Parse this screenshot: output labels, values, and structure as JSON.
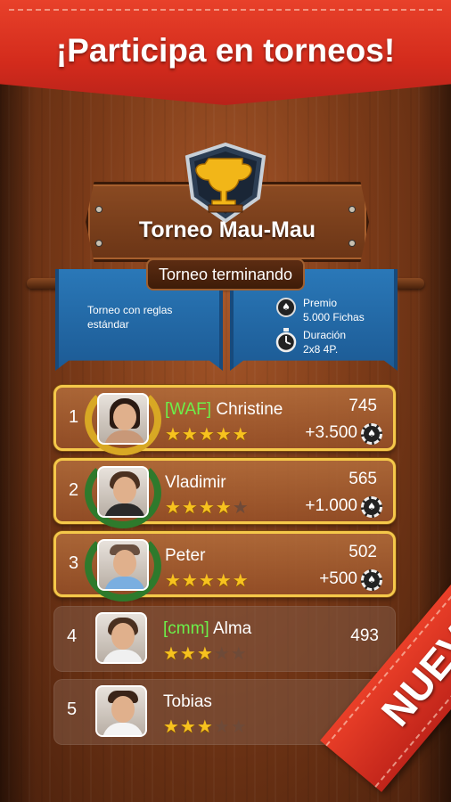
{
  "header": {
    "title": "¡Participa en torneos!"
  },
  "tournament": {
    "title": "Torneo Mau-Mau",
    "status": "Torneo terminando",
    "rules": "Torneo con reglas estándar",
    "prize_label": "Premio",
    "prize_value": "5.000 Fichas",
    "duration_label": "Duración",
    "duration_value": "2x8 4P."
  },
  "leaderboard": [
    {
      "rank": "1",
      "tag": "[WAF]",
      "name": "Christine",
      "score": "745",
      "prize": "+3.500",
      "stars": 5,
      "highlight": true
    },
    {
      "rank": "2",
      "tag": "",
      "name": "Vladimir",
      "score": "565",
      "prize": "+1.000",
      "stars": 4,
      "highlight": true
    },
    {
      "rank": "3",
      "tag": "",
      "name": "Peter",
      "score": "502",
      "prize": "+500",
      "stars": 5,
      "highlight": true
    },
    {
      "rank": "4",
      "tag": "[cmm]",
      "name": "Alma",
      "score": "493",
      "prize": "",
      "stars": 3,
      "highlight": false
    },
    {
      "rank": "5",
      "tag": "",
      "name": "Tobias",
      "score": "",
      "prize": "",
      "stars": 3,
      "highlight": false
    }
  ],
  "badge": {
    "text": "NUEVO"
  },
  "colors": {
    "ribbon": "#d32b1c",
    "tag": "#6cf04a",
    "gold_border": "#f5c84a",
    "banner": "#2a78b8"
  }
}
